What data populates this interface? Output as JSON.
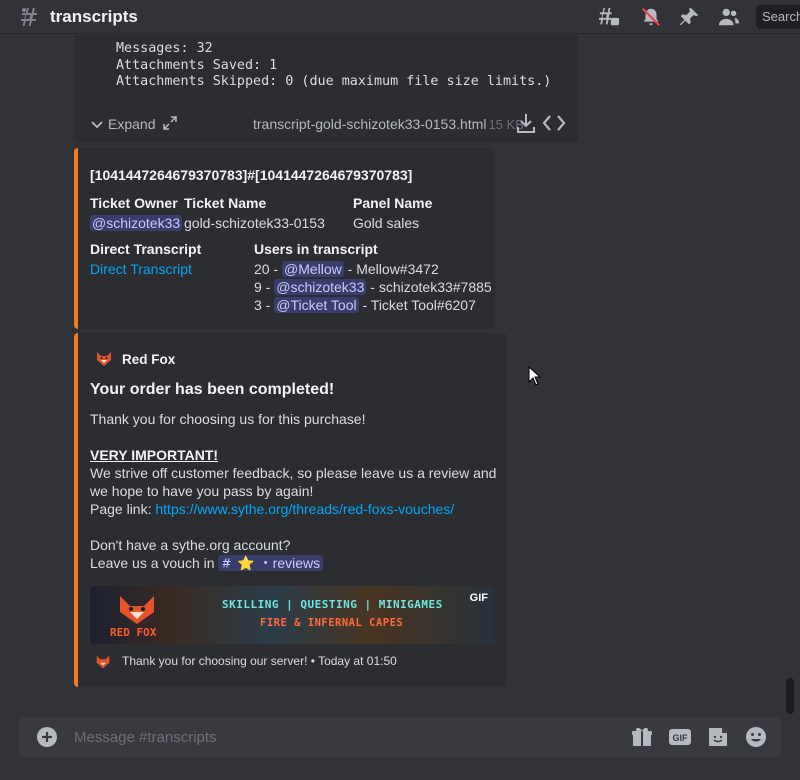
{
  "header": {
    "channel_name": "transcripts",
    "search_placeholder": "Search"
  },
  "attachment": {
    "code_lines": [
      "Messages: 32",
      "Attachments Saved: 1",
      "Attachments Skipped: 0 (due maximum file size limits.)"
    ],
    "expand_label": "Expand",
    "filename": "transcript-gold-schizotek33-0153.html",
    "filesize": "15 KB"
  },
  "ticket_embed": {
    "title": "[1041447264679370783]#[1041447264679370783]",
    "owner_label": "Ticket Owner",
    "owner_value": "@schizotek33",
    "name_label": "Ticket Name",
    "name_value": "gold-schizotek33-0153",
    "panel_label": "Panel Name",
    "panel_value": "Gold sales",
    "direct_label": "Direct Transcript",
    "direct_link": "Direct Transcript",
    "users_label": "Users in transcript",
    "users": [
      {
        "count": "20 - ",
        "mention": "@Mellow",
        "tag": " - Mellow#3472"
      },
      {
        "count": "9 - ",
        "mention": "@schizotek33",
        "tag": " - schizotek33#7885"
      },
      {
        "count": "3 - ",
        "mention": "@Ticket Tool",
        "tag": " - Ticket Tool#6207"
      }
    ]
  },
  "order_embed": {
    "author": "Red Fox",
    "title": "Your order has been completed!",
    "thanks": "Thank you for choosing us for this purchase!",
    "important": "VERY IMPORTANT!",
    "feedback": "We strive off customer feedback, so please leave us a review and we hope to have you pass by again!",
    "page_link_label": "Page link: ",
    "page_link": "https://www.sythe.org/threads/red-foxs-vouches/",
    "account_q": "Don't have a sythe.org account?",
    "vouch_prefix": "Leave us a vouch in ",
    "vouch_channel": "⭐ ・reviews",
    "banner_gif": "GIF",
    "banner_brand": "RED FOX",
    "banner_line1": "SKILLING | QUESTING | MINIGAMES",
    "banner_line2": "FIRE & INFERNAL CAPES",
    "footer": "Thank you for choosing our server! • Today at 01:50"
  },
  "composer": {
    "placeholder": "Message #transcripts"
  },
  "colors": {
    "accent": "#f47b20",
    "link": "#00a8fc",
    "mention_bg": "#3c4270"
  },
  "icons": [
    "hashtag-icon",
    "threads-icon",
    "mute-bell-icon",
    "pin-icon",
    "members-icon",
    "chevron-down-icon",
    "expand-arrows-icon",
    "download-icon",
    "code-icon",
    "plus-circle-icon",
    "gift-icon",
    "gif-icon",
    "sticker-icon",
    "emoji-icon"
  ]
}
